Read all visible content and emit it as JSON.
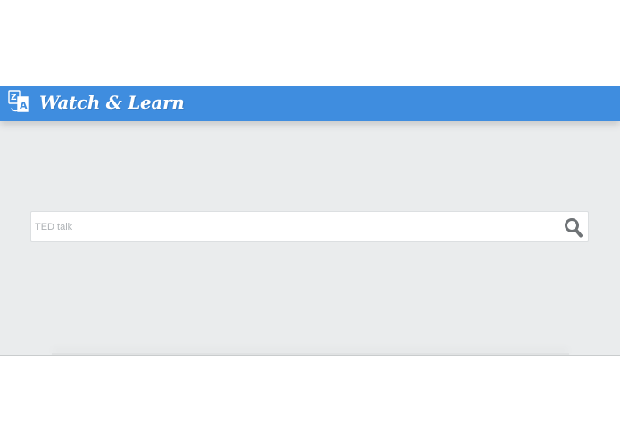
{
  "header": {
    "brand_title": "Watch & Learn",
    "brand_icon": "translate-icon",
    "background_color": "#3f8ddf"
  },
  "search": {
    "placeholder": "TED talk",
    "value": "",
    "button_icon": "search-icon"
  },
  "colors": {
    "background": "#eaeced",
    "accent": "#3f8ddf"
  }
}
